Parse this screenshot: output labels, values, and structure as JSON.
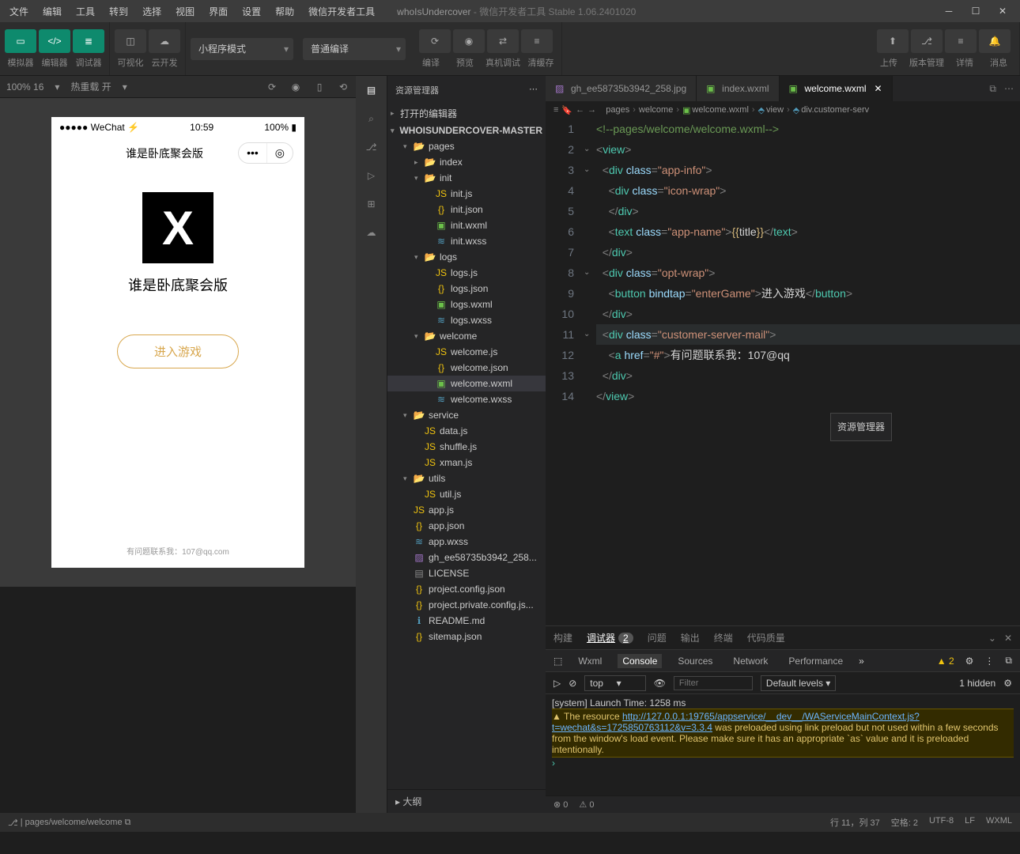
{
  "titlebar": {
    "menus": [
      "文件",
      "编辑",
      "工具",
      "转到",
      "选择",
      "视图",
      "界面",
      "设置",
      "帮助",
      "微信开发者工具"
    ],
    "appname": "whoIsUndercover",
    "suffix": " - 微信开发者工具 Stable 1.06.2401020"
  },
  "toolbar": {
    "group1": [
      "模拟器",
      "编辑器",
      "调试器"
    ],
    "group2": [
      "可视化",
      "云开发"
    ],
    "mode": "小程序模式",
    "compile": "普通编译",
    "mid_labels": [
      "编译",
      "预览",
      "真机调试",
      "清缓存"
    ],
    "right_labels": [
      "上传",
      "版本管理",
      "详情",
      "消息"
    ]
  },
  "subbar": {
    "zoom": "100% 16",
    "hotreload": "热重载 开"
  },
  "phone": {
    "carrier": "WeChat",
    "time": "10:59",
    "battery": "100%",
    "nav_title": "谁是卧底聚会版",
    "icon_text": "X",
    "app_name": "谁是卧底聚会版",
    "enter_btn": "进入游戏",
    "footer": "有问题联系我：107@qq.com"
  },
  "explorer": {
    "title": "资源管理器",
    "open_editors": "打开的编辑器",
    "project": "WHOISUNDERCOVER-MASTER",
    "outline": "大纲",
    "tree": [
      {
        "d": 1,
        "t": "folder",
        "n": "pages",
        "open": true
      },
      {
        "d": 2,
        "t": "folder",
        "n": "index"
      },
      {
        "d": 2,
        "t": "folder",
        "n": "init",
        "open": true
      },
      {
        "d": 3,
        "t": "js",
        "n": "init.js"
      },
      {
        "d": 3,
        "t": "json",
        "n": "init.json"
      },
      {
        "d": 3,
        "t": "wxml",
        "n": "init.wxml"
      },
      {
        "d": 3,
        "t": "wxss",
        "n": "init.wxss"
      },
      {
        "d": 2,
        "t": "folder",
        "n": "logs",
        "open": true
      },
      {
        "d": 3,
        "t": "js",
        "n": "logs.js"
      },
      {
        "d": 3,
        "t": "json",
        "n": "logs.json"
      },
      {
        "d": 3,
        "t": "wxml",
        "n": "logs.wxml"
      },
      {
        "d": 3,
        "t": "wxss",
        "n": "logs.wxss"
      },
      {
        "d": 2,
        "t": "folder",
        "n": "welcome",
        "open": true
      },
      {
        "d": 3,
        "t": "js",
        "n": "welcome.js"
      },
      {
        "d": 3,
        "t": "json",
        "n": "welcome.json"
      },
      {
        "d": 3,
        "t": "wxml",
        "n": "welcome.wxml",
        "sel": true
      },
      {
        "d": 3,
        "t": "wxss",
        "n": "welcome.wxss"
      },
      {
        "d": 1,
        "t": "folder",
        "n": "service",
        "open": true
      },
      {
        "d": 2,
        "t": "js",
        "n": "data.js"
      },
      {
        "d": 2,
        "t": "js",
        "n": "shuffle.js"
      },
      {
        "d": 2,
        "t": "js",
        "n": "xman.js"
      },
      {
        "d": 1,
        "t": "folder",
        "n": "utils",
        "open": true
      },
      {
        "d": 2,
        "t": "js",
        "n": "util.js"
      },
      {
        "d": 1,
        "t": "js",
        "n": "app.js"
      },
      {
        "d": 1,
        "t": "json",
        "n": "app.json"
      },
      {
        "d": 1,
        "t": "wxss",
        "n": "app.wxss"
      },
      {
        "d": 1,
        "t": "img",
        "n": "gh_ee58735b3942_258..."
      },
      {
        "d": 1,
        "t": "txt",
        "n": "LICENSE"
      },
      {
        "d": 1,
        "t": "json",
        "n": "project.config.json"
      },
      {
        "d": 1,
        "t": "json",
        "n": "project.private.config.js..."
      },
      {
        "d": 1,
        "t": "md",
        "n": "README.md"
      },
      {
        "d": 1,
        "t": "json",
        "n": "sitemap.json"
      }
    ]
  },
  "tabs": [
    {
      "icon": "img",
      "label": "gh_ee58735b3942_258.jpg"
    },
    {
      "icon": "wxml",
      "label": "index.wxml"
    },
    {
      "icon": "wxml",
      "label": "welcome.wxml",
      "active": true
    }
  ],
  "breadcrumb": [
    "pages",
    "welcome",
    "welcome.wxml",
    "view",
    "div.customer-serv"
  ],
  "code": {
    "tooltip": "资源管理器",
    "lines": [
      {
        "n": 1,
        "html": "<span class='tok-c'>&lt;!--pages/welcome/welcome.wxml--&gt;</span>"
      },
      {
        "n": 2,
        "fold": "v",
        "html": "<span class='tok-p'>&lt;</span><span class='tok-t'>view</span><span class='tok-p'>&gt;</span>"
      },
      {
        "n": 3,
        "fold": "v",
        "html": "  <span class='tok-p'>&lt;</span><span class='tok-t'>div</span> <span class='tok-a'>class</span><span class='tok-p'>=</span><span class='tok-s'>\"app-info\"</span><span class='tok-p'>&gt;</span>"
      },
      {
        "n": 4,
        "html": "    <span class='tok-p'>&lt;</span><span class='tok-t'>div</span> <span class='tok-a'>class</span><span class='tok-p'>=</span><span class='tok-s'>\"icon-wrap\"</span><span class='tok-p'>&gt;</span>"
      },
      {
        "n": 5,
        "html": "    <span class='tok-p'>&lt;/</span><span class='tok-t'>div</span><span class='tok-p'>&gt;</span>"
      },
      {
        "n": 6,
        "html": "    <span class='tok-p'>&lt;</span><span class='tok-t'>text</span> <span class='tok-a'>class</span><span class='tok-p'>=</span><span class='tok-s'>\"app-name\"</span><span class='tok-p'>&gt;</span><span class='tok-b'>{{</span><span class='tok-txt'>title</span><span class='tok-b'>}}</span><span class='tok-p'>&lt;/</span><span class='tok-t'>text</span><span class='tok-p'>&gt;</span>"
      },
      {
        "n": 7,
        "html": "  <span class='tok-p'>&lt;/</span><span class='tok-t'>div</span><span class='tok-p'>&gt;</span>"
      },
      {
        "n": 8,
        "fold": "v",
        "html": "  <span class='tok-p'>&lt;</span><span class='tok-t'>div</span> <span class='tok-a'>class</span><span class='tok-p'>=</span><span class='tok-s'>\"opt-wrap\"</span><span class='tok-p'>&gt;</span>"
      },
      {
        "n": 9,
        "html": "    <span class='tok-p'>&lt;</span><span class='tok-t'>button</span> <span class='tok-a'>bindtap</span><span class='tok-p'>=</span><span class='tok-s'>\"enterGame\"</span><span class='tok-p'>&gt;</span><span class='tok-txt'>进入游戏</span><span class='tok-p'>&lt;/</span><span class='tok-t'>button</span><span class='tok-p'>&gt;</span>"
      },
      {
        "n": 10,
        "html": "  <span class='tok-p'>&lt;/</span><span class='tok-t'>div</span><span class='tok-p'>&gt;</span>"
      },
      {
        "n": 11,
        "fold": "v",
        "hl": true,
        "html": "  <span class='tok-p'>&lt;</span><span class='tok-t'>div</span> <span class='tok-a'>class</span><span class='tok-p'>=</span><span class='tok-s'>\"customer-server-mail\"</span><span class='tok-p'>&gt;</span>"
      },
      {
        "n": 12,
        "html": "    <span class='tok-p'>&lt;</span><span class='tok-t'>a</span> <span class='tok-a'>href</span><span class='tok-p'>=</span><span class='tok-s'>\"#\"</span><span class='tok-p'>&gt;</span><span class='tok-txt'>有问题联系我：107@qq</span>"
      },
      {
        "n": 13,
        "html": "  <span class='tok-p'>&lt;/</span><span class='tok-t'>div</span><span class='tok-p'>&gt;</span>"
      },
      {
        "n": 14,
        "html": "<span class='tok-p'>&lt;/</span><span class='tok-t'>view</span><span class='tok-p'>&gt;</span>"
      }
    ]
  },
  "debug": {
    "tabs": [
      "构建",
      "调试器",
      "问题",
      "输出",
      "终端",
      "代码质量"
    ],
    "active_tab": "调试器",
    "badge": "2",
    "subtabs": [
      "Wxml",
      "Console",
      "Sources",
      "Network",
      "Performance"
    ],
    "active_subtab": "Console",
    "warn_count": "2",
    "top": "top",
    "filter_placeholder": "Filter",
    "levels": "Default levels",
    "hidden": "1 hidden",
    "sys_line": "[system] Launch Time: 1258 ms",
    "warn_prefix": "The resource ",
    "warn_url": "http://127.0.0.1:19765/appservice/__dev__/WAServiceMainContext.js?t=wechat&s=1725850763112&v=3.3.4",
    "warn_suffix": " was preloaded using link preload but not used within a few seconds from the window's load event. Please make sure it has an appropriate `as` value and it is preloaded intentionally."
  },
  "editor_status": {
    "errors": "0",
    "warnings": "0"
  },
  "statusbar": {
    "path": "pages/welcome/welcome",
    "pos": "行 11，列 37",
    "spaces": "空格: 2",
    "enc": "UTF-8",
    "eol": "LF",
    "lang": "WXML"
  }
}
